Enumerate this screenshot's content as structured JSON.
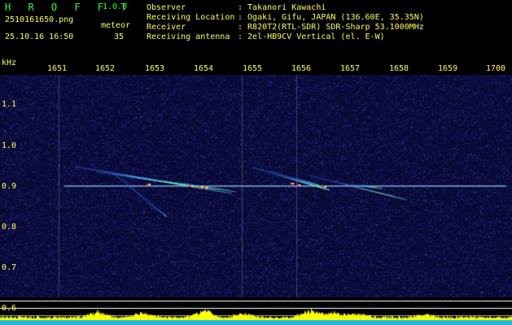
{
  "header": {
    "app_name": "H R O F F T",
    "app_version": "1.0.0",
    "filename": "2510161650.png",
    "timestamp": "25.10.16 16:50",
    "type_label": "meteor",
    "type_count": "35",
    "info": [
      {
        "label": "Observer",
        "value": ": Takanori Kawachi"
      },
      {
        "label": "Receiving Location",
        "value": ": Ogaki, Gifu, JAPAN (136.60E, 35.35N)"
      },
      {
        "label": "Receiver",
        "value": ": R820T2(RTL-SDR) SDR-Sharp 53.1000MHz"
      },
      {
        "label": "Receiving antenna",
        "value": ": 2el-HB9CV Vertical (el. E-W)"
      }
    ]
  },
  "axis": {
    "unit": "kHz",
    "time_ticks": [
      "1651",
      "1652",
      "1653",
      "1654",
      "1655",
      "1656",
      "1657",
      "1658",
      "1659",
      "1700"
    ],
    "freq_ticks": [
      "1.1",
      "1.0",
      "0.9",
      "0.8",
      "0.7",
      "0.6"
    ]
  },
  "colors": {
    "background": "#0a0a36",
    "header_green": "#33ff33",
    "label_yellow": "#ffff44",
    "level_fill": "#ffff00",
    "level_base": "#22b8d8"
  }
}
